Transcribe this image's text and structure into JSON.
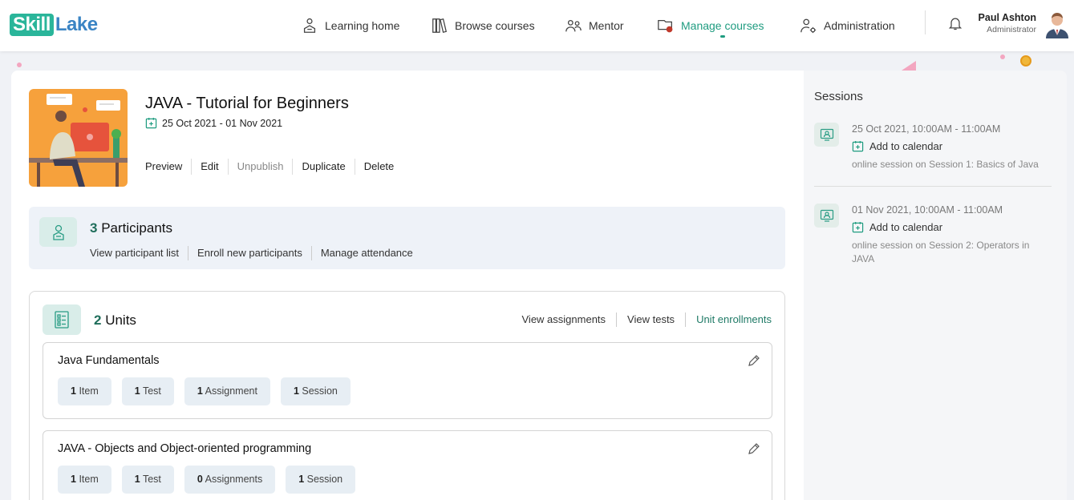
{
  "header": {
    "logo_part1": "Skill",
    "logo_part2": "Lake",
    "nav": [
      {
        "label": "Learning home",
        "icon": "learning-home-icon"
      },
      {
        "label": "Browse courses",
        "icon": "books-icon"
      },
      {
        "label": "Mentor",
        "icon": "mentor-icon"
      },
      {
        "label": "Manage courses",
        "icon": "manage-courses-icon",
        "active": true
      },
      {
        "label": "Administration",
        "icon": "admin-gear-user-icon"
      }
    ],
    "user_name": "Paul Ashton",
    "user_role": "Administrator"
  },
  "course": {
    "title": "JAVA - Tutorial for Beginners",
    "dates": "25 Oct 2021 - 01 Nov 2021",
    "actions": {
      "preview": "Preview",
      "edit": "Edit",
      "unpublish": "Unpublish",
      "duplicate": "Duplicate",
      "delete": "Delete"
    }
  },
  "participants": {
    "count": "3",
    "label": "Participants",
    "links": {
      "view": "View participant list",
      "enroll": "Enroll new participants",
      "attendance": "Manage attendance"
    }
  },
  "units": {
    "count": "2",
    "label": "Units",
    "links": {
      "assignments": "View assignments",
      "tests": "View tests",
      "enrollments": "Unit enrollments"
    },
    "items": [
      {
        "name": "Java Fundamentals",
        "chips": [
          {
            "n": "1",
            "t": "Item"
          },
          {
            "n": "1",
            "t": "Test"
          },
          {
            "n": "1",
            "t": "Assignment"
          },
          {
            "n": "1",
            "t": "Session"
          }
        ]
      },
      {
        "name": "JAVA - Objects and Object-oriented programming",
        "chips": [
          {
            "n": "1",
            "t": "Item"
          },
          {
            "n": "1",
            "t": "Test"
          },
          {
            "n": "0",
            "t": "Assignments"
          },
          {
            "n": "1",
            "t": "Session"
          }
        ]
      }
    ]
  },
  "sessions": {
    "title": "Sessions",
    "items": [
      {
        "time": "25 Oct 2021, 10:00AM - 11:00AM",
        "calendar": "Add to calendar",
        "desc": "online session on Session 1: Basics of Java"
      },
      {
        "time": "01 Nov 2021, 10:00AM - 11:00AM",
        "calendar": "Add to calendar",
        "desc": "online session on Session 2: Operators in JAVA"
      }
    ]
  },
  "colors": {
    "accent": "#1f9c80",
    "brand_green": "#2ab59a",
    "brand_blue": "#3a84c4"
  }
}
